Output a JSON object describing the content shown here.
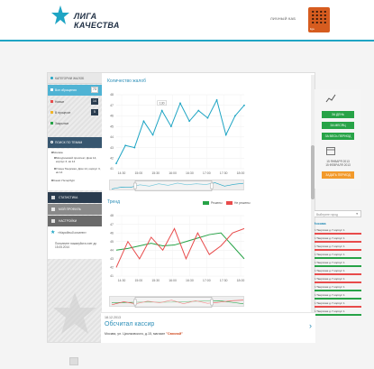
{
  "header": {
    "logo_line1": "ЛИГА",
    "logo_line2": "КАЧЕСТВА",
    "login_link": "ЛИЧНЫЙ КАБ",
    "qr_label": "liga",
    "accent_color": "#1fa5c4"
  },
  "sidebar": {
    "head_label": "КАТЕГОРИИ ЖАЛОБ",
    "all_label": "Все обращения",
    "all_count": "73",
    "statuses": [
      {
        "label": "Новые",
        "count": "14",
        "color": "#e84b4b"
      },
      {
        "label": "В процессе",
        "count": "5",
        "color": "#f0b429"
      },
      {
        "label": "Закрытые",
        "count": "",
        "color": "#27a347"
      }
    ],
    "filter_head": "ПОИСК ПО ТЕМАМ",
    "filter_items": [
      "Москва",
      "Мичуринский проспект, Дом 14, корпус 3, кв 14",
      "Улица Тверская, Дом 14, корпус 3, кв 14",
      "Санкт-Петербург"
    ],
    "menu": [
      {
        "label": "СТАТИСТИКА",
        "color": "#2a3c4f"
      },
      {
        "label": "МОЙ ПРОФИЛЬ",
        "color": "#8a8a8a"
      },
      {
        "label": "НАСТРОЙКИ",
        "color": "#6a6a6a"
      }
    ],
    "promo_title": "«Народный клиент»",
    "promo_text": "Пополните пожалуйста счет до 15.05.2014"
  },
  "complaints_chart": {
    "title": "Количество жалоб",
    "tooltip": "130"
  },
  "right_panel": {
    "btn_day": "ЗА ДЕНЬ",
    "btn_month": "ЗА МЕСЯЦ",
    "btn_all": "ЗА ВЕСЬ ПЕРИОД",
    "date_from": "15 ЯНВАРЯ 2013",
    "date_to": "15 ФЕВРАЛЯ 2013",
    "btn_period": "ЗАДАТЬ ПЕРИОД"
  },
  "trends": {
    "title": "Тренд",
    "legend_good": "Решены",
    "legend_bad": "Не решены",
    "select_placeholder": "Выберите город",
    "city": "Москва",
    "addresses": [
      {
        "text": "ул.Тверская д.7 корпус 1",
        "state": "red"
      },
      {
        "text": "ул.Тверская д.7 корпус 1",
        "state": "red"
      },
      {
        "text": "ул.Тверская д.7 корпус 1",
        "state": "red"
      },
      {
        "text": "ул.Тверская д.7 корпус 1",
        "state": "green"
      },
      {
        "text": "ул.Тверская д.7 корпус 1",
        "state": "green"
      },
      {
        "text": "ул.Тверская д.7 корпус 1",
        "state": "red"
      },
      {
        "text": "ул.Тверская д.7 корпус 1",
        "state": "red"
      },
      {
        "text": "ул.Тверская д.7 корпус 1",
        "state": "green"
      },
      {
        "text": "ул.Тверская д.7 корпус 1",
        "state": "green"
      },
      {
        "text": "ул.Тверская д.7 корпус 1",
        "state": "red"
      },
      {
        "text": "ул.Тверская д.7 корпус 1",
        "state": "green"
      }
    ]
  },
  "news": {
    "date": "18.12.2013",
    "title": "Обсчитал кассир",
    "address": "Москва, ул. Циолковского, д.15, магазин",
    "shop": "\"Связной\""
  },
  "chart_data": [
    {
      "type": "line",
      "title": "Количество жалоб",
      "x": [
        "14:30",
        "15:00",
        "15:30",
        "16:00",
        "16:30",
        "17:00",
        "17:30",
        "18:00"
      ],
      "y_ticks": [
        "41",
        "42",
        "43",
        "44",
        "45",
        "46",
        "47",
        "48"
      ],
      "series": [
        {
          "color": "#1fa5c4",
          "values": [
            41.5,
            43.2,
            43.0,
            45.5,
            44.2,
            46.5,
            45.0,
            47.2,
            45.5,
            46.5,
            45.8,
            47.5,
            44.2,
            46.0,
            47.0
          ]
        }
      ],
      "ylim": [
        41,
        48
      ]
    },
    {
      "type": "line",
      "title": "Тренд",
      "x": [
        "14:30",
        "15:00",
        "15:30",
        "16:00",
        "16:30",
        "17:00",
        "17:30",
        "18:00"
      ],
      "y_ticks": [
        "41",
        "42",
        "43",
        "44",
        "45",
        "46",
        "47",
        "48"
      ],
      "series": [
        {
          "name": "Решены",
          "color": "#27a347",
          "values": [
            44.0,
            44.2,
            44.5,
            44.8,
            44.5,
            44.6,
            45.0,
            45.4,
            45.8,
            46.0,
            44.5,
            43.0
          ]
        },
        {
          "name": "Не решены",
          "color": "#e84b4b",
          "values": [
            42.0,
            45.0,
            43.0,
            45.5,
            44.0,
            46.5,
            43.0,
            46.0,
            43.5,
            44.5,
            46.0,
            46.5
          ]
        }
      ],
      "ylim": [
        41,
        48
      ]
    }
  ]
}
